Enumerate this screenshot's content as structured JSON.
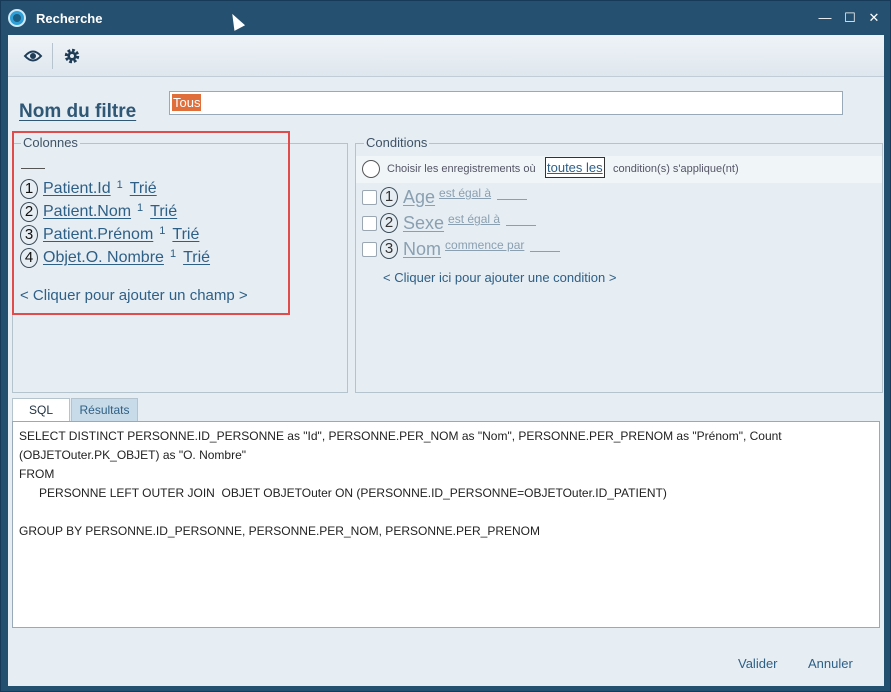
{
  "window": {
    "title": "Recherche",
    "minimize": "—",
    "maximize": "☐",
    "close": "✕"
  },
  "toolbar": {
    "preview_icon": "eye-icon",
    "settings_icon": "gear-icon"
  },
  "filter": {
    "label": "Nom du filtre",
    "value": "Tous"
  },
  "columns": {
    "title": "Colonnes",
    "items": [
      {
        "num": "1",
        "field": "Patient.Id",
        "sort_index": "1",
        "sort": "Trié"
      },
      {
        "num": "2",
        "field": "Patient.Nom",
        "sort_index": "1",
        "sort": "Trié"
      },
      {
        "num": "3",
        "field": "Patient.Prénom",
        "sort_index": "1",
        "sort": "Trié"
      },
      {
        "num": "4",
        "field": "Objet.O. Nombre",
        "sort_index": "1",
        "sort": "Trié"
      }
    ],
    "add_label": "< Cliquer pour ajouter un champ >"
  },
  "conditions": {
    "title": "Conditions",
    "choose_prefix": "Choisir les enregistrements où",
    "mode": "toutes les",
    "choose_suffix": "condition(s) s'applique(nt)",
    "items": [
      {
        "num": "1",
        "field": "Age",
        "op": "est égal à"
      },
      {
        "num": "2",
        "field": "Sexe",
        "op": "est égal à"
      },
      {
        "num": "3",
        "field": "Nom",
        "op": "commence par"
      }
    ],
    "add_label": "< Cliquer ici pour ajouter une condition >"
  },
  "tabs": {
    "sql": "SQL",
    "results": "Résultats"
  },
  "sql_text": "SELECT DISTINCT PERSONNE.ID_PERSONNE as \"Id\", PERSONNE.PER_NOM as \"Nom\", PERSONNE.PER_PRENOM as \"Prénom\", Count\n(OBJETOuter.PK_OBJET) as \"O. Nombre\"\nFROM\n      PERSONNE LEFT OUTER JOIN  OBJET OBJETOuter ON (PERSONNE.ID_PERSONNE=OBJETOuter.ID_PATIENT)\n\nGROUP BY PERSONNE.ID_PERSONNE, PERSONNE.PER_NOM, PERSONNE.PER_PRENOM",
  "footer": {
    "ok": "Valider",
    "cancel": "Annuler"
  }
}
